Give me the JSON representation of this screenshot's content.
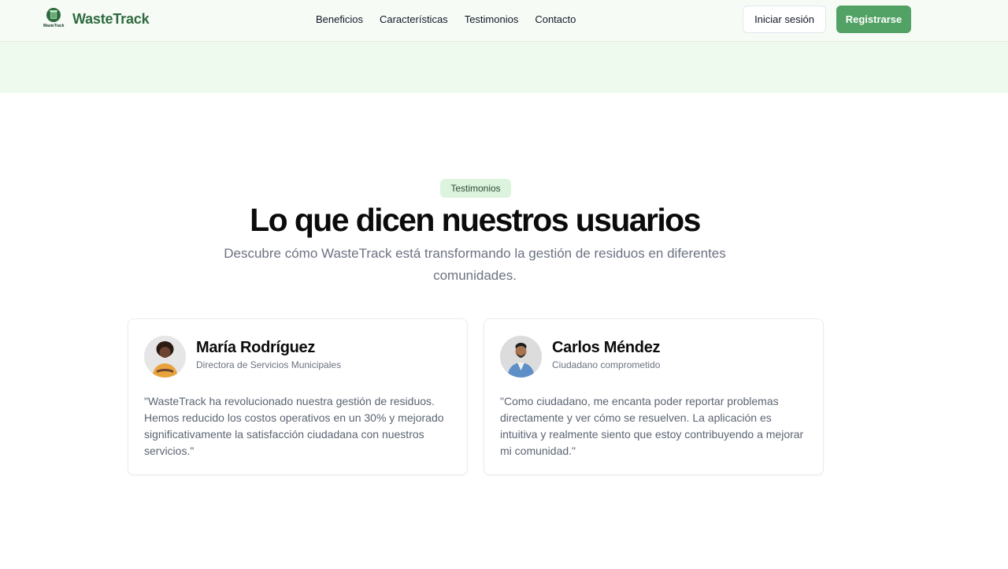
{
  "header": {
    "logo_caption": "WasteTrack",
    "brand": "WasteTrack",
    "nav": [
      "Beneficios",
      "Características",
      "Testimonios",
      "Contacto"
    ],
    "login_label": "Iniciar sesión",
    "register_label": "Registrarse"
  },
  "section": {
    "badge": "Testimonios",
    "title": "Lo que dicen nuestros usuarios",
    "subtitle": "Descubre cómo WasteTrack está transformando la gestión de residuos en diferentes comunidades."
  },
  "testimonials": [
    {
      "name": "María Rodríguez",
      "role": "Directora de Servicios Municipales",
      "quote": "\"WasteTrack ha revolucionado nuestra gestión de residuos. Hemos reducido los costos operativos en un 30% y mejorado significativamente la satisfacción ciudadana con nuestros servicios.\""
    },
    {
      "name": "Carlos Méndez",
      "role": "Ciudadano comprometido",
      "quote": "\"Como ciudadano, me encanta poder reportar problemas directamente y ver cómo se resuelven. La aplicación es intuitiva y realmente siento que estoy contribuyendo a mejorar mi comunidad.\""
    }
  ],
  "colors": {
    "brand_green": "#2f6b3f",
    "accent_button": "#52a165",
    "badge_bg": "#dcf4de",
    "band_bg": "#eefaee"
  }
}
